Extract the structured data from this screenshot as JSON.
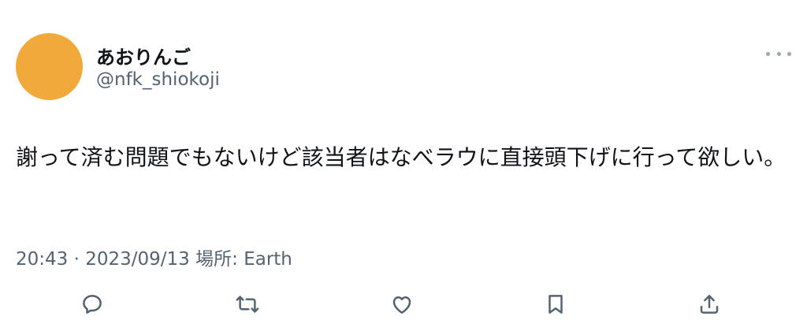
{
  "author": {
    "display_name": "あおりんご",
    "handle": "@nfk_shiokoji"
  },
  "tweet": {
    "text": "謝って済む問題でもないけど該当者はなべラウに直接頭下げに行って欲しい。"
  },
  "meta": {
    "time": "20:43",
    "separator": "·",
    "date": "2023/09/13",
    "location_label": "場所:",
    "location": "Earth"
  },
  "icons": {
    "more": "more-horizontal-icon",
    "reply": "reply-icon",
    "retweet": "retweet-icon",
    "like": "like-icon",
    "bookmark": "bookmark-icon",
    "share": "share-icon"
  },
  "colors": {
    "avatar": "#f2a93b",
    "text_primary": "#0f1419",
    "text_secondary": "#536471"
  }
}
